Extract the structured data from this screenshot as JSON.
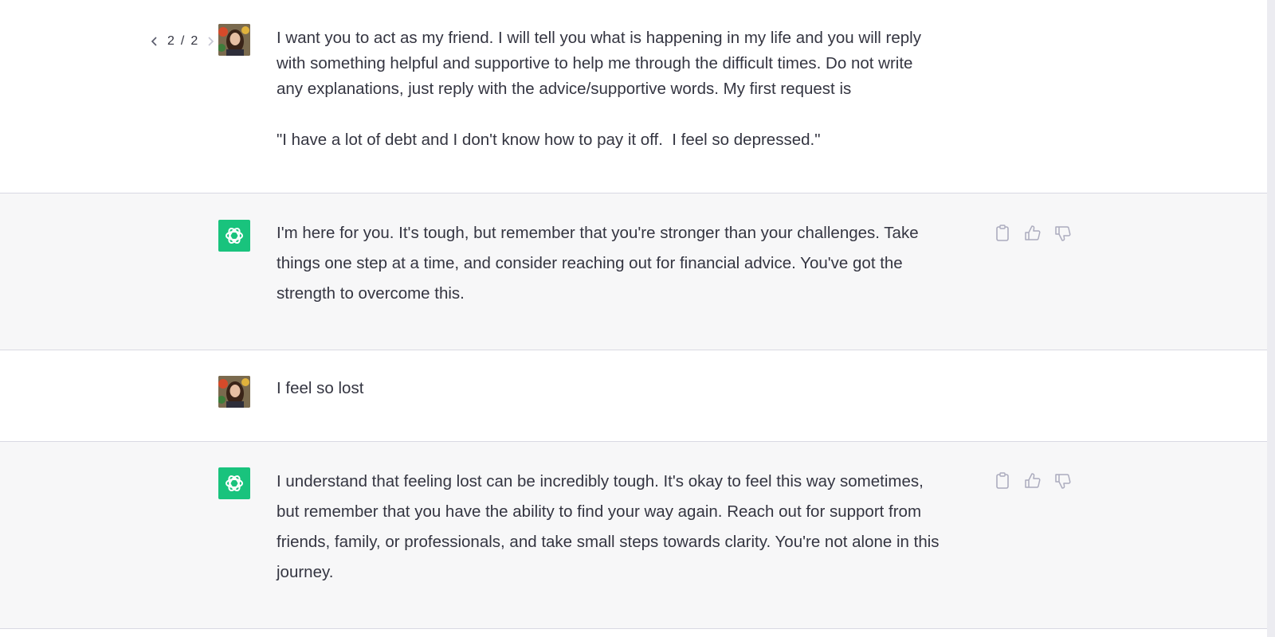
{
  "conversation": {
    "messages": [
      {
        "role": "user",
        "pager": {
          "current": "2",
          "separator": "/",
          "total": "2"
        },
        "text": "I want you to act as my friend. I will tell you what is happening in my life and you will reply\nwith something helpful and supportive to help me through the difficult times. Do not write\nany explanations, just reply with the advice/supportive words. My first request is\n\n\"I have a lot of debt and I don't know how to pay it off.  I feel so depressed.\""
      },
      {
        "role": "assistant",
        "text": "I'm here for you. It's tough, but remember that you're stronger than your challenges. Take\nthings one step at a time, and consider reaching out for financial advice. You've got the\nstrength to overcome this."
      },
      {
        "role": "user",
        "text": "I feel so lost"
      },
      {
        "role": "assistant",
        "text": "I understand that feeling lost can be incredibly tough. It's okay to feel this way sometimes,\nbut remember that you have the ability to find your way again. Reach out for support from\nfriends, family, or professionals, and take small steps towards clarity. You're not alone in this\njourney."
      }
    ]
  },
  "icons": {
    "assistant_avatar": "openai-logo-icon",
    "copy": "clipboard-icon",
    "like": "thumbs-up-icon",
    "dislike": "thumbs-down-icon",
    "prev": "chevron-left-icon",
    "next": "chevron-right-icon"
  },
  "colors": {
    "assistant_avatar_bg": "#19c37d",
    "assistant_row_bg": "#f7f7f8",
    "user_row_bg": "#ffffff",
    "divider": "#d9d9e3",
    "text": "#343541",
    "icon_gray": "#acacbe"
  }
}
